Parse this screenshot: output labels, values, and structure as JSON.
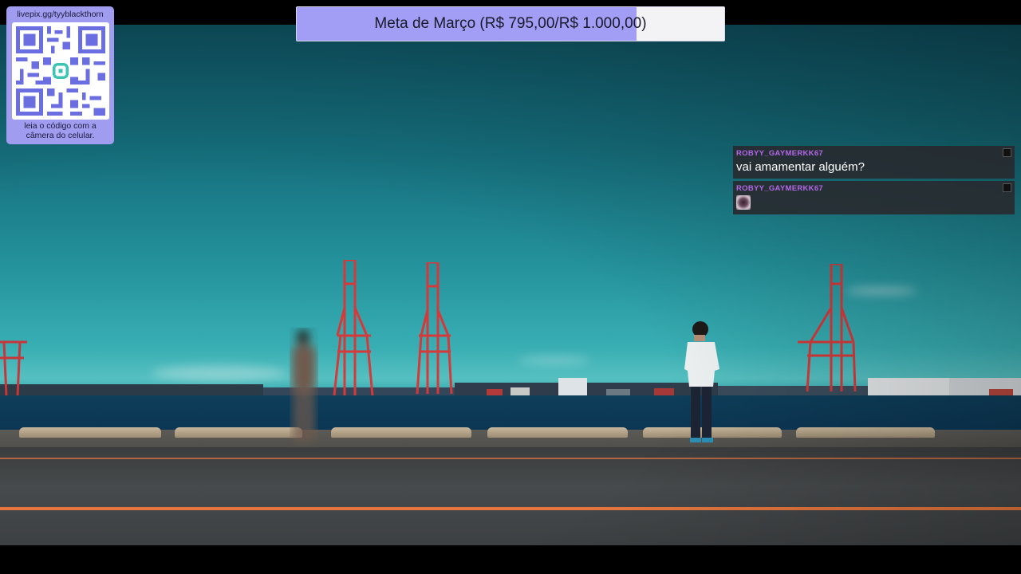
{
  "qr_panel": {
    "url": "livepix.gg/tyyblackthorn",
    "hint_line1": "leia o código com a",
    "hint_line2": "câmera do celular."
  },
  "goal": {
    "label": "Meta de Março (R$ 795,00/R$ 1.000,00)",
    "current": 795,
    "target": 1000,
    "fill_color": "#a39ef5"
  },
  "chat": {
    "messages": [
      {
        "user": "ROBYY_GAYMERKK67",
        "text": "vai amamentar alguém?",
        "has_emote": false
      },
      {
        "user": "ROBYY_GAYMERKK67",
        "text": "",
        "has_emote": true
      }
    ]
  },
  "colors": {
    "accent": "#a39ef5",
    "username": "#b367e8",
    "road_line": "#e6763e",
    "crane": "#d6393a"
  },
  "icons": {
    "qr": "qr-code-icon",
    "badge": "user-badge-icon",
    "emote": "emote-icon"
  }
}
